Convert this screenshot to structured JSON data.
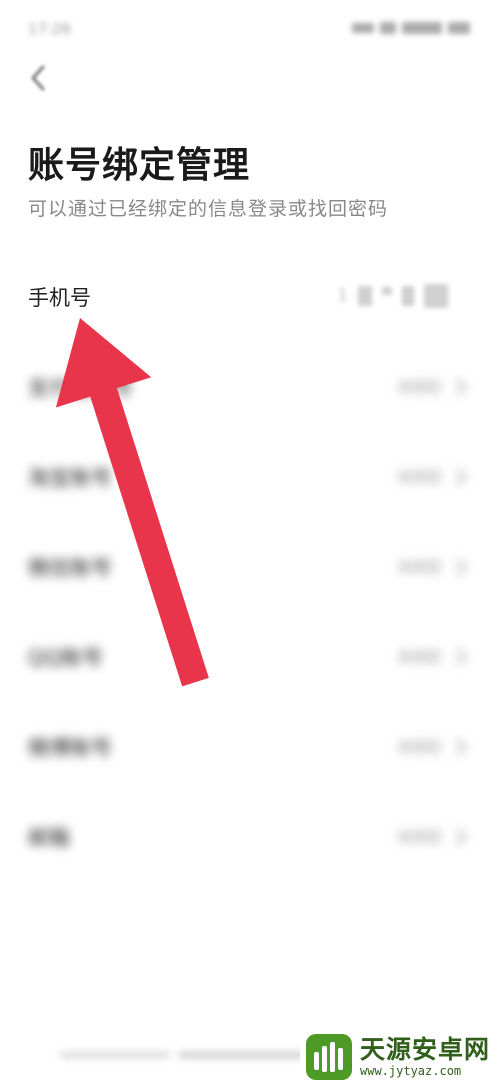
{
  "status_bar": {
    "time": "17:26"
  },
  "header": {
    "title": "账号绑定管理",
    "subtitle": "可以通过已经绑定的信息登录或找回密码"
  },
  "accounts": [
    {
      "label": "手机号",
      "value": "1"
    },
    {
      "label": "支付宝账号",
      "value": "未绑定"
    },
    {
      "label": "淘宝账号",
      "value": "未绑定"
    },
    {
      "label": "微信账号",
      "value": "未绑定"
    },
    {
      "label": "QQ账号",
      "value": "未绑定"
    },
    {
      "label": "微博账号",
      "value": "未绑定"
    },
    {
      "label": "邮箱",
      "value": "未绑定"
    }
  ],
  "watermark": {
    "name": "天源安卓网",
    "url": "www.jytyaz.com"
  },
  "colors": {
    "arrow": "#e8354b",
    "background": "#ffffff",
    "watermark_green": "#2f5f1a"
  }
}
